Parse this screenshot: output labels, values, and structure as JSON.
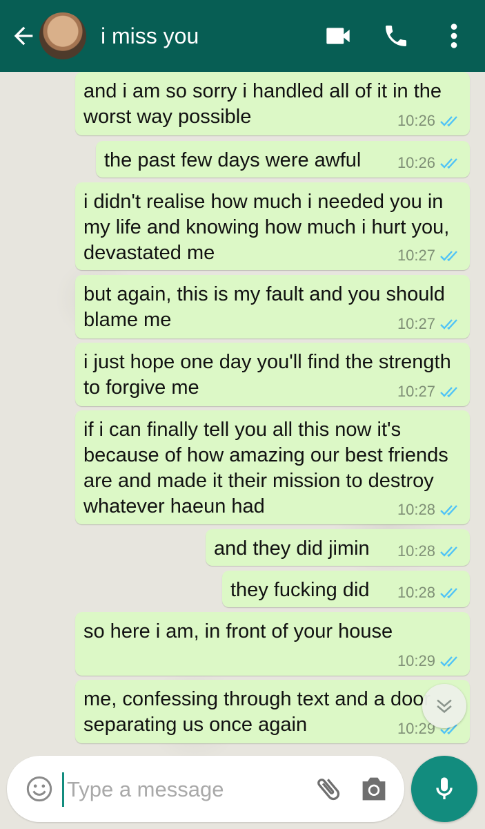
{
  "header": {
    "title": "i miss you",
    "back_icon": "arrow-back-icon",
    "icons": [
      "video-call-icon",
      "voice-call-icon",
      "more-vert-icon"
    ]
  },
  "messages": [
    {
      "text": "and i am so sorry i handled all of it in the worst way possible",
      "time": "10:26"
    },
    {
      "text": "the past few days were awful",
      "time": "10:26"
    },
    {
      "text": "i didn't realise how much i needed you in my life and knowing how much i hurt you, devastated me",
      "time": "10:27"
    },
    {
      "text": "but again, this is my fault and you should blame me",
      "time": "10:27"
    },
    {
      "text": "i just hope one day you'll find the strength to forgive me",
      "time": "10:27"
    },
    {
      "text": "if i can finally tell you all this now it's because of how amazing our best friends are and made it their mission to destroy whatever haeun had",
      "time": "10:28"
    },
    {
      "text": "and they did jimin",
      "time": "10:28"
    },
    {
      "text": "they fucking did",
      "time": "10:28"
    },
    {
      "text": "so here i am, in front of your house",
      "time": "10:29"
    },
    {
      "text": "me, confessing through text and a door separating us once again",
      "time": "10:29"
    }
  ],
  "composer": {
    "placeholder": "Type a message",
    "value": ""
  },
  "colors": {
    "header": "#075e54",
    "bubble_out": "#dcf8c6",
    "read_ticks": "#4fc3f7",
    "accent": "#128c7e"
  }
}
